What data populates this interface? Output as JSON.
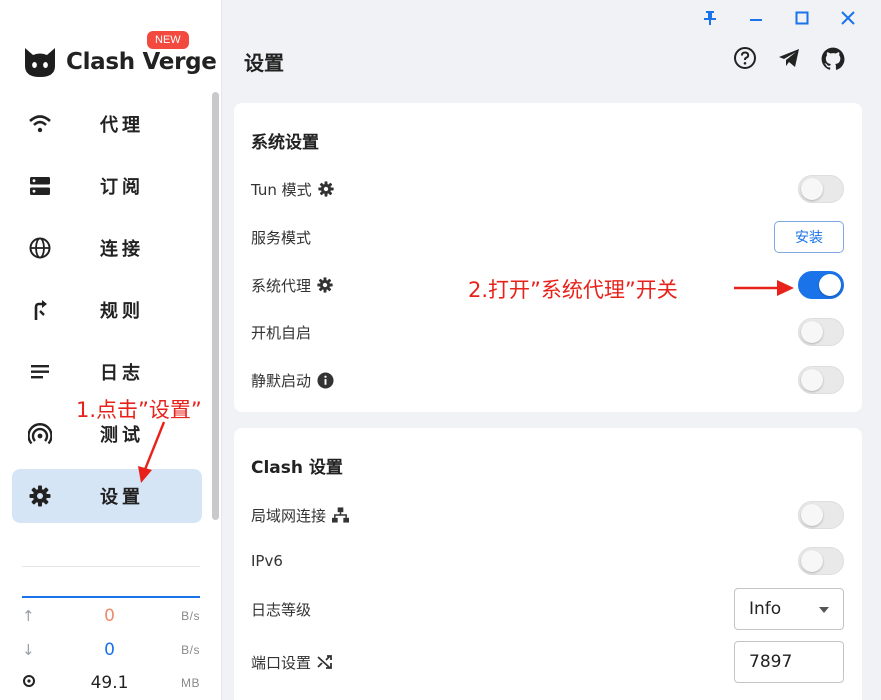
{
  "app": {
    "name": "Clash Verge",
    "badge": "NEW"
  },
  "window_controls": [
    "pin-icon",
    "minimize-icon",
    "maximize-icon",
    "close-icon"
  ],
  "header": {
    "title": "设置",
    "icons": [
      "help-icon",
      "telegram-icon",
      "github-icon"
    ]
  },
  "sidebar": {
    "items": [
      {
        "label": "代理",
        "icon": "wifi-icon"
      },
      {
        "label": "订阅",
        "icon": "server-icon"
      },
      {
        "label": "连接",
        "icon": "globe-icon"
      },
      {
        "label": "规则",
        "icon": "route-icon"
      },
      {
        "label": "日志",
        "icon": "list-icon"
      },
      {
        "label": "测试",
        "icon": "radar-icon"
      },
      {
        "label": "设置",
        "icon": "gear-icon",
        "active": true
      }
    ],
    "traffic": {
      "up": {
        "value": "0",
        "unit": "B/s"
      },
      "down": {
        "value": "0",
        "unit": "B/s"
      },
      "memory": {
        "value": "49.1",
        "unit": "MB"
      }
    }
  },
  "system_settings": {
    "title": "系统设置",
    "rows": [
      {
        "label": "Tun 模式",
        "icon": "gear-icon",
        "control": "toggle",
        "on": false
      },
      {
        "label": "服务模式",
        "control": "button",
        "button_label": "安装"
      },
      {
        "label": "系统代理",
        "icon": "gear-icon",
        "control": "toggle",
        "on": true
      },
      {
        "label": "开机自启",
        "control": "toggle",
        "on": false
      },
      {
        "label": "静默启动",
        "icon": "info-icon",
        "control": "toggle",
        "on": false
      }
    ]
  },
  "clash_settings": {
    "title": "Clash 设置",
    "rows": [
      {
        "label": "局域网连接",
        "icon": "network-icon",
        "control": "toggle",
        "on": false
      },
      {
        "label": "IPv6",
        "control": "toggle",
        "on": false
      },
      {
        "label": "日志等级",
        "control": "select",
        "value": "Info"
      },
      {
        "label": "端口设置",
        "icon": "shuffle-icon",
        "control": "input",
        "value": "7897"
      }
    ]
  },
  "annotations": {
    "step1": "1.点击”设置”",
    "step2": "2.打开”系统代理”开关"
  },
  "colors": {
    "accent": "#1a73e8",
    "annotation": "#e8221b",
    "badge": "#f24a3f",
    "upload_value": "#f08a6c",
    "download_value": "#1a73e8"
  }
}
